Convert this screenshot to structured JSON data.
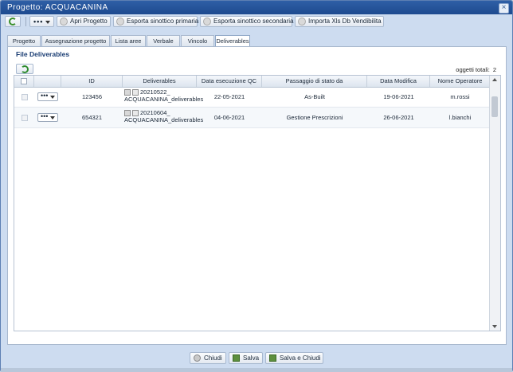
{
  "window": {
    "title": "Progetto: ACQUACANINA",
    "close_glyph": "×"
  },
  "toolbar": {
    "actions_dots": "•••",
    "buttons": [
      {
        "label": "Apri Progetto"
      },
      {
        "label": "Esporta sinottico primaria"
      },
      {
        "label": "Esporta sinottico secondaria"
      },
      {
        "label": "Importa Xls Db Vendibilita"
      }
    ]
  },
  "tabs": [
    {
      "label": "Progetto"
    },
    {
      "label": "Assegnazione progetto"
    },
    {
      "label": "Lista aree"
    },
    {
      "label": "Verbale"
    },
    {
      "label": "Vincolo"
    },
    {
      "label": "Deliverables",
      "active": true
    }
  ],
  "panel": {
    "title": "File Deliverables",
    "total_label": "oggetti totali:",
    "total_value": "2"
  },
  "grid": {
    "columns": [
      "ID",
      "Deliverables",
      "Data esecuzione QC",
      "Passaggio di stato da",
      "Data Modifica",
      "Nome Operatore"
    ],
    "rows": [
      {
        "actions": "•••",
        "id": "123456",
        "deliv_line1": "20210522_",
        "deliv_line2": "ACQUACANINA_deliverables",
        "data_qc": "22-05-2021",
        "stato": "As-Built",
        "data_mod": "19-06-2021",
        "operatore": "m.rossi"
      },
      {
        "actions": "•••",
        "id": "654321",
        "deliv_line1": "20210604_",
        "deliv_line2": "ACQUACANINA_deliverables",
        "data_qc": "04-06-2021",
        "stato": "Gestione Prescrizioni",
        "data_mod": "26-06-2021",
        "operatore": "l.bianchi"
      }
    ]
  },
  "footer": {
    "close_label": "Chiudi",
    "save_label": "Salva",
    "save_close_label": "Salva e Chiudi"
  },
  "icons": {
    "refresh": "refresh-icon",
    "actions": "more-actions-icon",
    "file_preview": "file-preview-icon",
    "file_download": "file-download-icon"
  },
  "colors": {
    "titlebar": "#1d4a8f",
    "accent_green": "#3a8f2a",
    "panel_title": "#1a3d73"
  }
}
